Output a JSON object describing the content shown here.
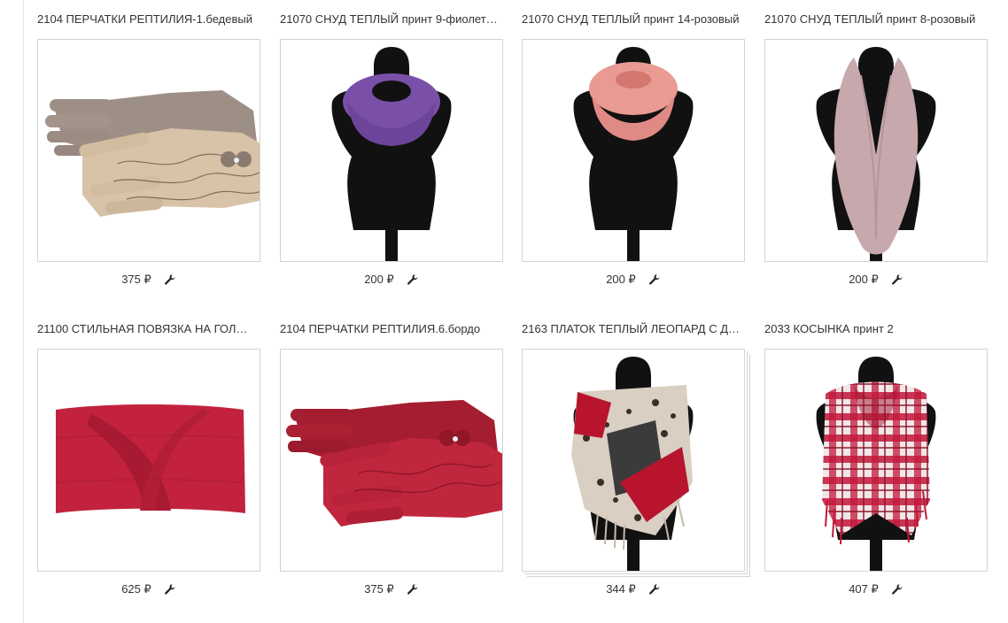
{
  "currency": "₽",
  "products": [
    {
      "title": "2104 ПЕРЧАТКИ РЕПТИЛИЯ-1.бедевый",
      "price": "375 ₽",
      "image": "gloves-beige"
    },
    {
      "title": "21070 СНУД ТЕПЛЫЙ принт 9-фиолет…",
      "price": "200 ₽",
      "image": "snood-purple"
    },
    {
      "title": "21070 СНУД ТЕПЛЫЙ принт 14-розовый",
      "price": "200 ₽",
      "image": "snood-pink"
    },
    {
      "title": "21070 СНУД ТЕПЛЫЙ принт 8-розовый",
      "price": "200 ₽",
      "image": "snood-mauve"
    },
    {
      "title": "21100 СТИЛЬНАЯ ПОВЯЗКА НА ГОЛ…",
      "price": "625 ₽",
      "image": "headband-red"
    },
    {
      "title": "2104 ПЕРЧАТКИ РЕПТИЛИЯ.6.бордо",
      "price": "375 ₽",
      "image": "gloves-red"
    },
    {
      "title": "2163 ПЛАТОК ТЕПЛЫЙ ЛЕОПАРД С Д…",
      "price": "344 ₽",
      "image": "scarf-leopard"
    },
    {
      "title": "2033 КОСЫНКА принт 2",
      "price": "407 ₽",
      "image": "scarf-plaid"
    }
  ],
  "colors": {
    "text": "#333333",
    "border": "#d4d4d4",
    "mannequin": "#111111"
  },
  "icons": {
    "edit": "wrench-icon"
  }
}
